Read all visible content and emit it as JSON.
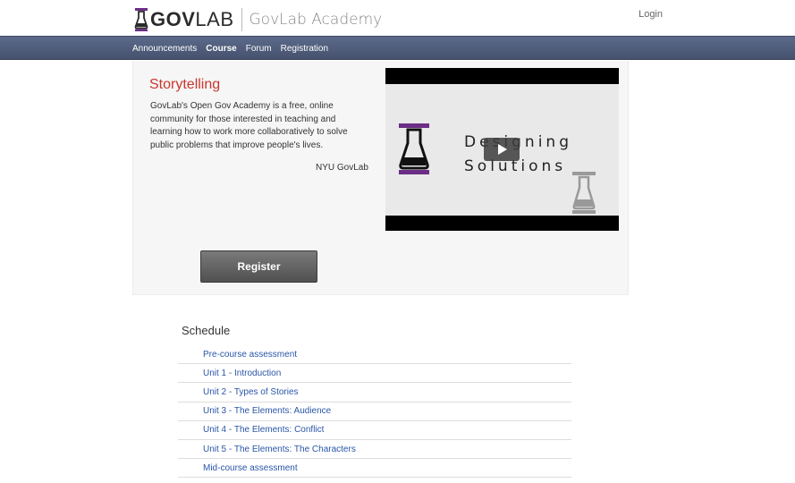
{
  "header": {
    "logo_gov": "GOV",
    "logo_lab": "LAB",
    "academy": "GovLab Academy",
    "login": "Login"
  },
  "nav": {
    "items": [
      {
        "label": "Announcements",
        "active": false
      },
      {
        "label": "Course",
        "active": true
      },
      {
        "label": "Forum",
        "active": false
      },
      {
        "label": "Registration",
        "active": false
      }
    ]
  },
  "hero": {
    "title": "Storytelling",
    "description": "GovLab's Open Gov Academy is a free, online community for those interested in teaching and learning how to work more collaboratively to solve public problems that improve people's lives.",
    "author": "NYU GovLab",
    "video": {
      "line1": "Designing",
      "line2": "Solutions"
    },
    "register_label": "Register"
  },
  "schedule": {
    "title": "Schedule",
    "items": [
      "Pre-course assessment",
      "Unit 1 - Introduction",
      "Unit 2 - Types of Stories",
      "Unit 3 - The Elements: Audience",
      "Unit 4 - The Elements: Conflict",
      "Unit 5 - The Elements: The Characters",
      "Mid-course assessment"
    ]
  },
  "colors": {
    "accent_red": "#c8372d",
    "nav_bg": "#4f5c7b",
    "link_blue": "#2a56a8",
    "brand_purple": "#6b2d86"
  }
}
